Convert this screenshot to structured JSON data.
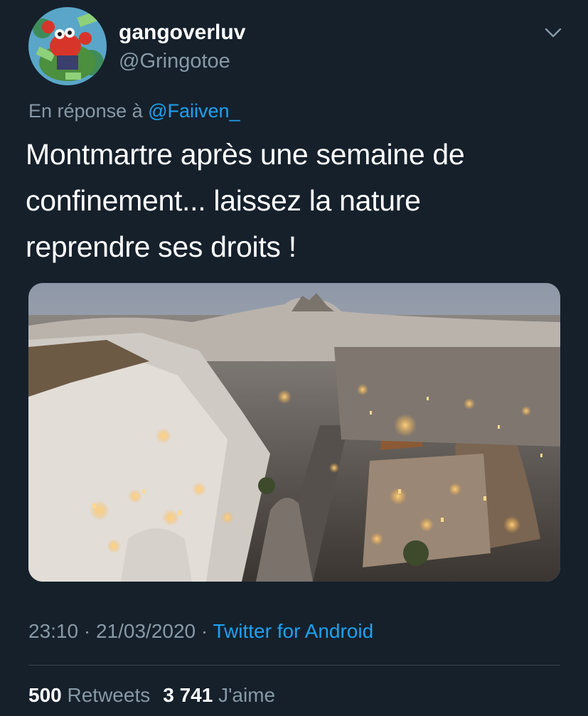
{
  "tweet": {
    "author": {
      "display_name": "gangoverluv",
      "handle": "@Gringotoe"
    },
    "reply": {
      "prefix": "En réponse à ",
      "mention": "@Faiiven_"
    },
    "text_lines": [
      "Montmartre après une semaine de",
      "confinement... laissez la nature",
      "reprendre ses droits !"
    ],
    "meta": {
      "time": "23:10",
      "sep1": " · ",
      "date": "21/03/2020",
      "sep2": " · ",
      "source": "Twitter for Android"
    },
    "stats": {
      "retweets_count": "500",
      "retweets_label": "Retweets",
      "likes_count": "3 741",
      "likes_label": "J'aime"
    }
  },
  "icons": {
    "more": "chevron-down-icon"
  },
  "colors": {
    "background": "#15202b",
    "secondary_text": "#8899a6",
    "link": "#1da1f2",
    "divider": "#38444d"
  }
}
